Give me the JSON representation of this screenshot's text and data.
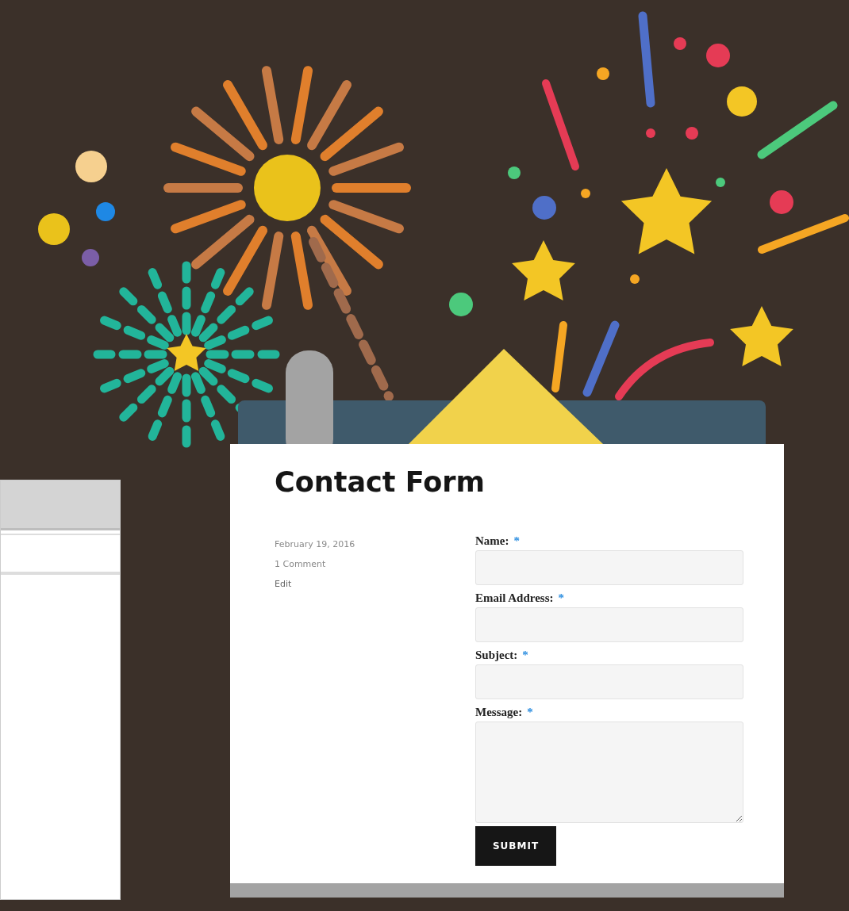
{
  "page_title": "Contact Form",
  "meta": [
    {
      "kind": "date",
      "text": "February 19, 2016"
    },
    {
      "kind": "comments",
      "text": "1 Comment"
    },
    {
      "kind": "link",
      "text": "Edit"
    }
  ],
  "form": {
    "fields": [
      {
        "label": "Name:",
        "required_mark": "*",
        "kind": "text"
      },
      {
        "label": "Email Address:",
        "required_mark": "*",
        "kind": "text"
      },
      {
        "label": "Subject:",
        "required_mark": "*",
        "kind": "text"
      },
      {
        "label": "Message:",
        "required_mark": "*",
        "kind": "textarea"
      }
    ],
    "submit": "SUBMIT"
  }
}
